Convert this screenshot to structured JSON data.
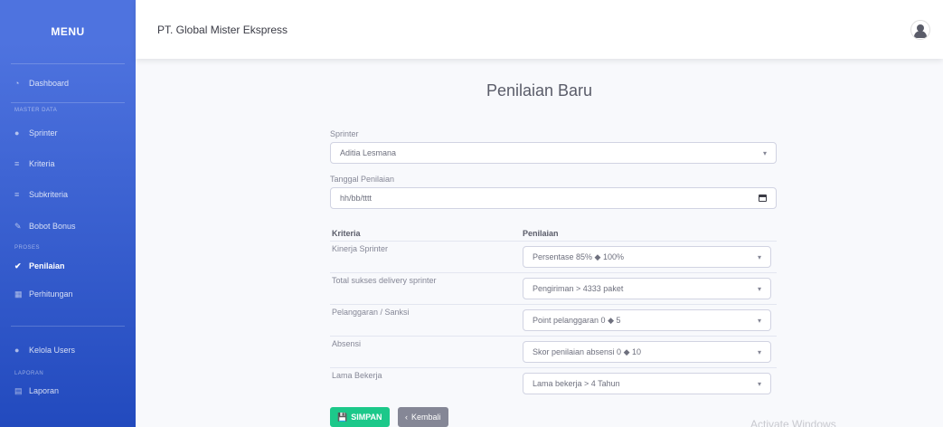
{
  "sidebar": {
    "brand": "MENU",
    "items": [
      {
        "icon": "tachometer-icon",
        "label": "Dashboard"
      },
      {
        "heading": "MASTER DATA"
      },
      {
        "icon": "user-icon",
        "label": "Sprinter"
      },
      {
        "icon": "list-icon",
        "label": "Kriteria"
      },
      {
        "icon": "list-icon",
        "label": "Subkriteria"
      },
      {
        "icon": "pencil-icon",
        "label": "Bobot Bonus"
      },
      {
        "heading": "PROSES"
      },
      {
        "icon": "check-icon",
        "label": "Penilaian",
        "active": true
      },
      {
        "icon": "calculator-icon",
        "label": "Perhitungan"
      },
      {
        "icon": "users-icon",
        "label": "Kelola Users"
      },
      {
        "heading": "LAPORAN"
      },
      {
        "icon": "file-icon",
        "label": "Laporan"
      }
    ]
  },
  "topbar": {
    "title": "PT. Global Mister Ekspress"
  },
  "form": {
    "title": "Penilaian Baru",
    "sprinter_label": "Sprinter",
    "sprinter_value": "Aditia Lesmana",
    "date_label": "Tanggal Penilaian",
    "date_placeholder": "hh/bb/tttt",
    "col_kriteria": "Kriteria",
    "col_penilaian": "Penilaian",
    "rows": [
      {
        "kriteria": "Kinerja Sprinter",
        "penilaian": "Persentase 85% ◆ 100%"
      },
      {
        "kriteria": "Total sukses delivery sprinter",
        "penilaian": "Pengiriman > 4333 paket"
      },
      {
        "kriteria": "Pelanggaran / Sanksi",
        "penilaian": "Point pelanggaran 0 ◆ 5"
      },
      {
        "kriteria": "Absensi",
        "penilaian": "Skor penilaian absensi 0 ◆ 10"
      },
      {
        "kriteria": "Lama Bekerja",
        "penilaian": "Lama bekerja > 4 Tahun"
      }
    ],
    "save_label": "SIMPAN",
    "back_label": "Kembali"
  },
  "watermark": "Activate Windows"
}
